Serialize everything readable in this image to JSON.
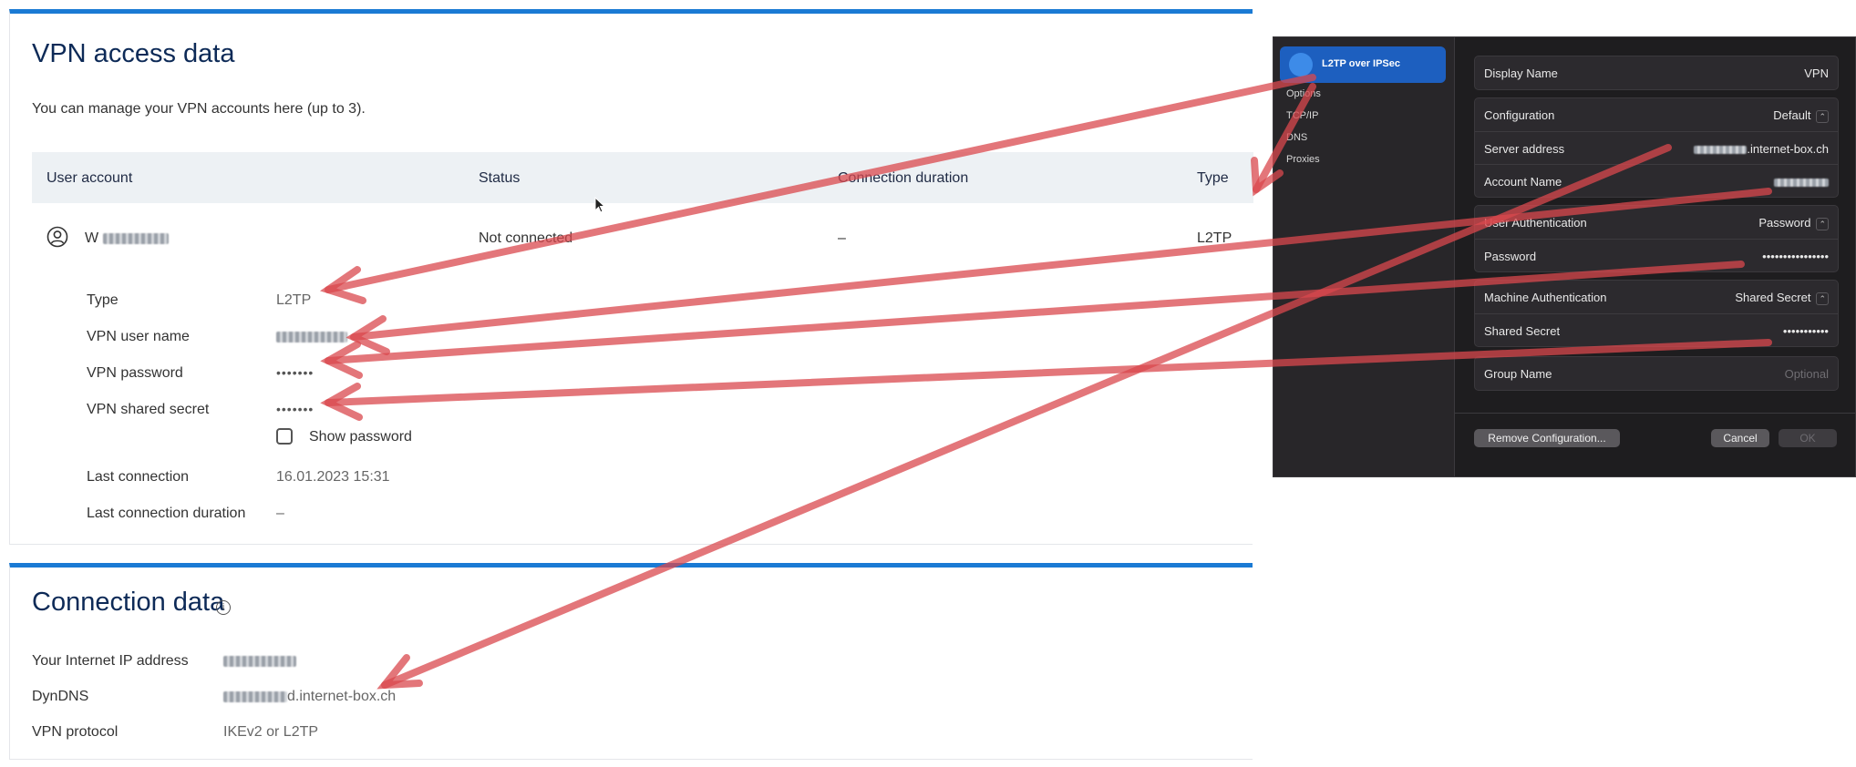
{
  "vpn_card": {
    "title": "VPN access data",
    "description": "You can manage your VPN accounts here (up to 3).",
    "columns": [
      "User account",
      "Status",
      "Connection duration",
      "Type"
    ],
    "row": {
      "user_prefix": "W",
      "status": "Not connected",
      "duration": "–",
      "type": "L2TP"
    },
    "details": {
      "type_label": "Type",
      "type_value": "L2TP",
      "username_label": "VPN user name",
      "password_label": "VPN password",
      "password_value": "•••••••",
      "secret_label": "VPN shared secret",
      "secret_value": "•••••••",
      "show_password_label": "Show password",
      "last_connection_label": "Last connection",
      "last_connection_value": "16.01.2023 15:31",
      "last_duration_label": "Last connection duration",
      "last_duration_value": "–"
    }
  },
  "connection_card": {
    "title": "Connection data",
    "ip_label": "Your Internet IP address",
    "dyndns_label": "DynDNS",
    "dyndns_suffix": "d.internet-box.ch",
    "protocol_label": "VPN protocol",
    "protocol_value": "IKEv2 or L2TP"
  },
  "mac_panel": {
    "selected_item": "L2TP over IPSec",
    "nav_items": [
      "Options",
      "TCP/IP",
      "DNS",
      "Proxies"
    ],
    "display_name_label": "Display Name",
    "display_name_value": "VPN",
    "configuration_label": "Configuration",
    "configuration_value": "Default",
    "server_address_label": "Server address",
    "server_address_suffix": ".internet-box.ch",
    "account_name_label": "Account Name",
    "user_auth_label": "User Authentication",
    "user_auth_value": "Password",
    "password_label": "Password",
    "password_value": "••••••••••••••••",
    "machine_auth_label": "Machine Authentication",
    "machine_auth_value": "Shared Secret",
    "shared_secret_label": "Shared Secret",
    "shared_secret_value": "•••••••••••",
    "group_name_label": "Group Name",
    "group_name_placeholder": "Optional",
    "remove_button": "Remove Configuration...",
    "cancel_button": "Cancel",
    "ok_button": "OK"
  },
  "colors": {
    "accent": "#1a7ad4",
    "title": "#0d2a57",
    "arrow": "#d9484e",
    "mac_selected": "#1d5fbf"
  }
}
